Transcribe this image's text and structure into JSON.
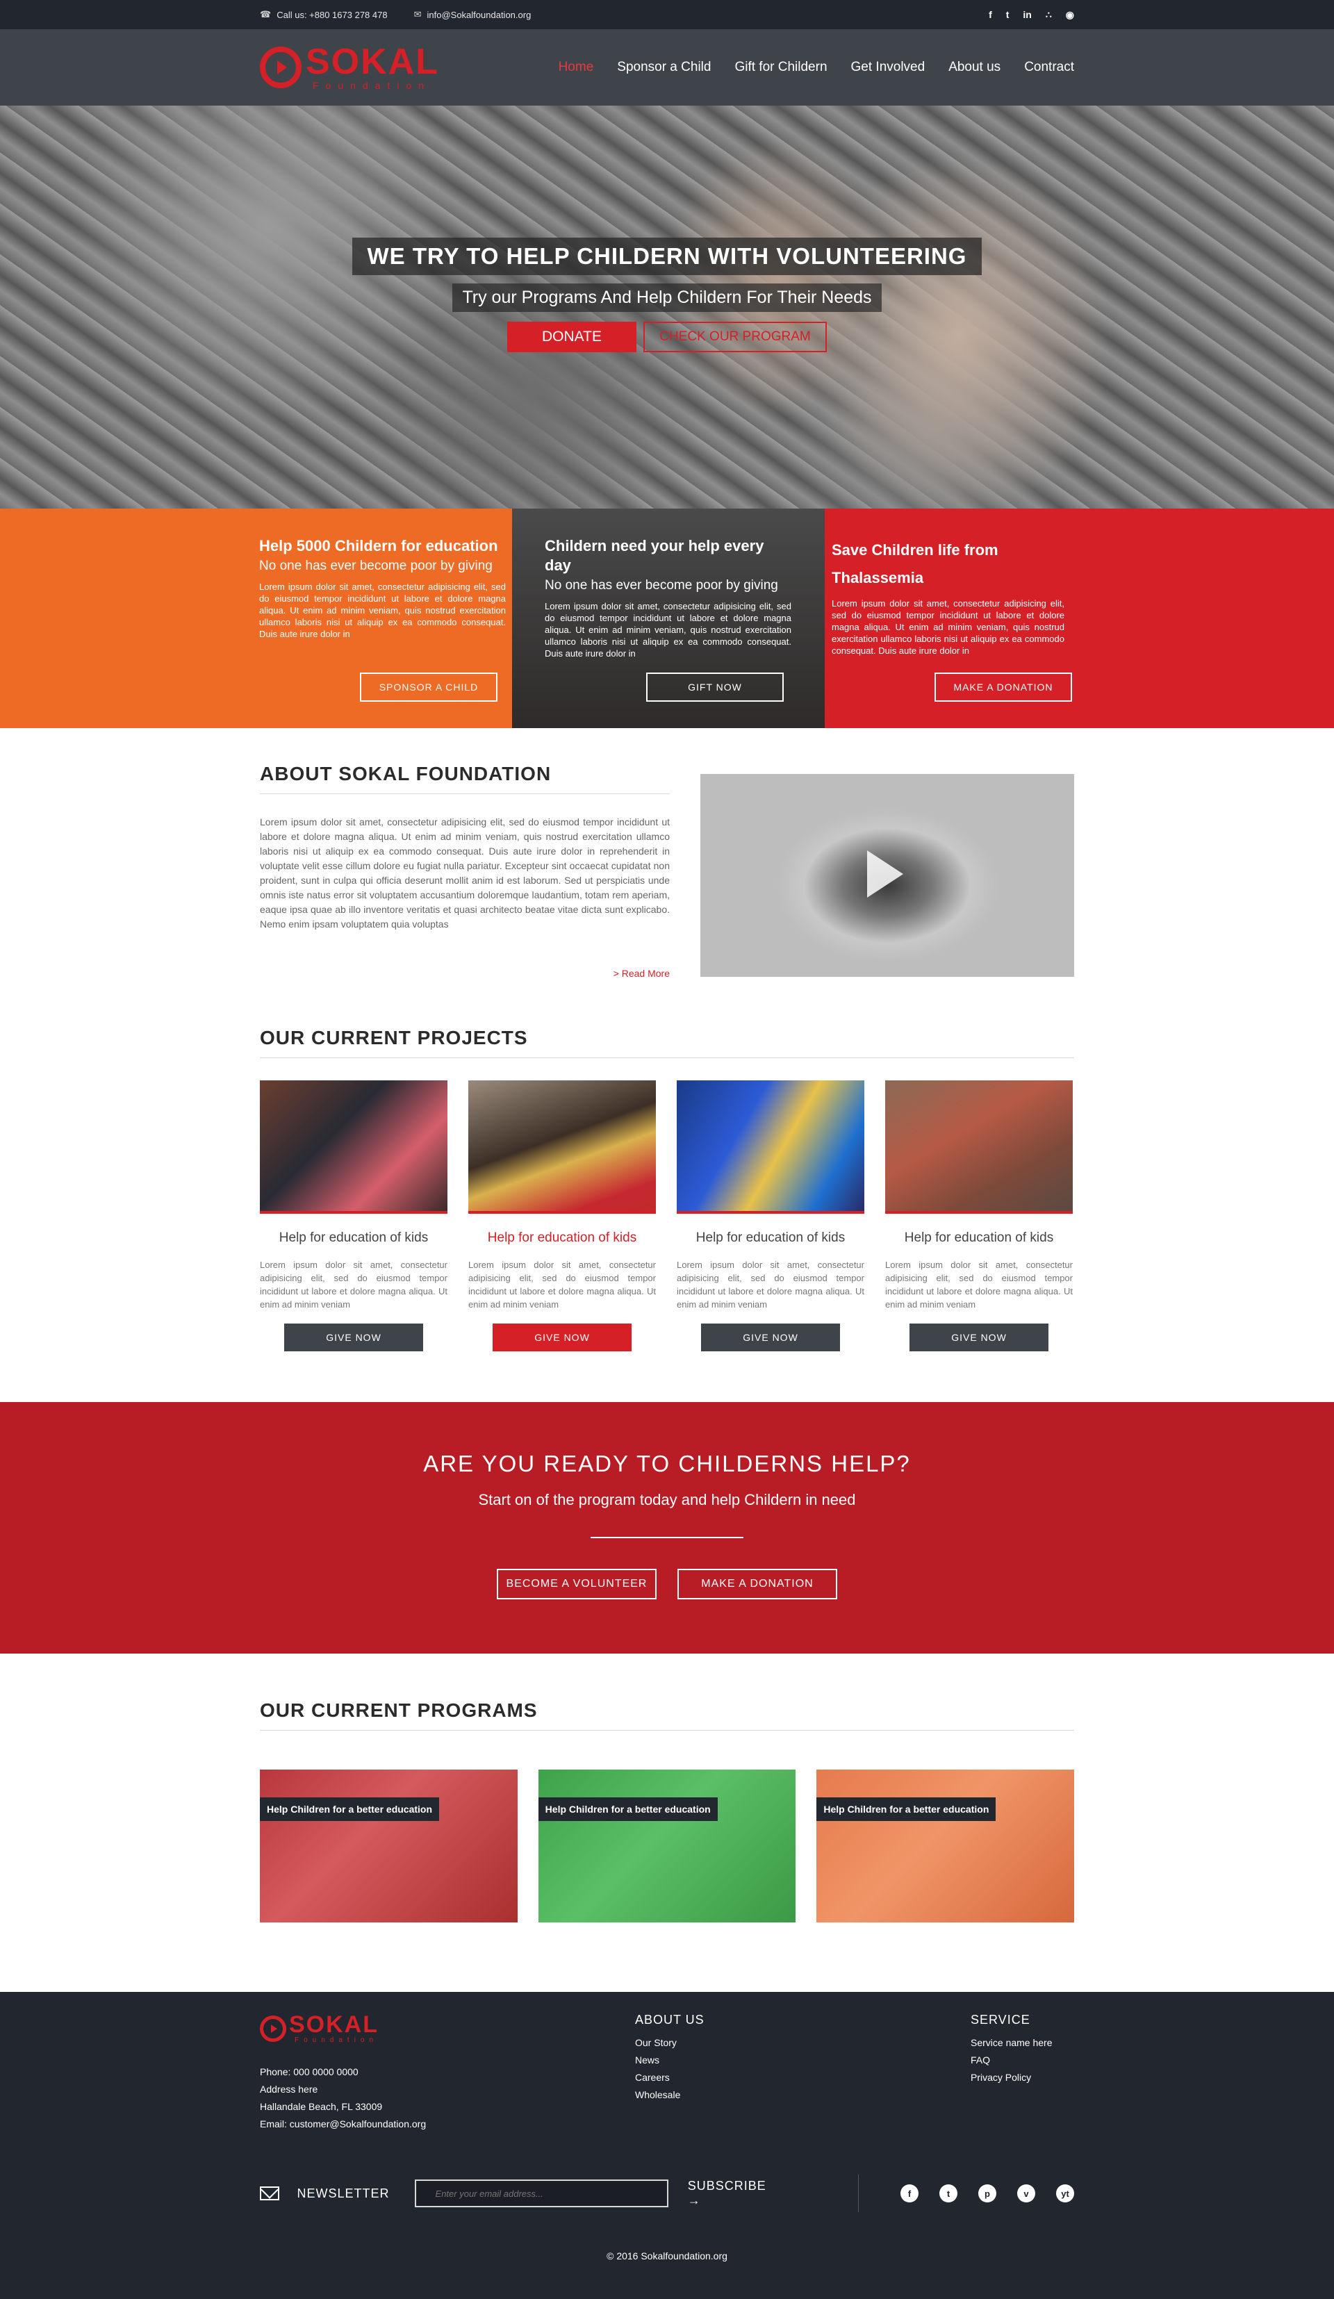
{
  "topbar": {
    "phone": "Call us: +880 1673 278 478",
    "email": "info@Sokalfoundation.org",
    "social": [
      "f",
      "t",
      "in",
      "rss",
      "dribbble"
    ]
  },
  "header": {
    "logo_name": "SOKAL",
    "logo_sub": "Foundation",
    "nav": [
      "Home",
      "Sponsor a Child",
      "Gift for Childern",
      "Get Involved",
      "About us",
      "Contract"
    ],
    "active_nav": "Home"
  },
  "hero": {
    "title": "WE TRY TO HELP CHILDERN WITH VOLUNTEERING",
    "subtitle": "Try our Programs And Help Childern For Their Needs",
    "donate": "DONATE",
    "check": "CHECK OUR PROGRAM"
  },
  "features": [
    {
      "title": "Help 5000 Childern for education",
      "subtitle": "No one has ever become poor by giving",
      "text": "Lorem ipsum dolor sit amet, consectetur adipisicing elit, sed do eiusmod tempor incididunt ut labore et dolore magna aliqua. Ut enim ad minim veniam, quis nostrud exercitation ullamco laboris nisi ut aliquip ex ea commodo consequat. Duis aute irure dolor in",
      "button": "SPONSOR A CHILD"
    },
    {
      "title": "Childern need your help every day",
      "subtitle": "No one has ever become poor by giving",
      "text": "Lorem ipsum dolor sit amet, consectetur adipisicing elit, sed do eiusmod tempor incididunt ut labore et dolore magna aliqua. Ut enim ad minim veniam, quis nostrud exercitation ullamco laboris nisi ut aliquip ex ea commodo consequat. Duis aute irure dolor in",
      "button": "GIFT NOW"
    },
    {
      "title": "Save Children life from Thalassemia",
      "subtitle": "",
      "text": "Lorem ipsum dolor sit amet, consectetur adipisicing elit, sed do eiusmod tempor incididunt ut labore et dolore magna aliqua. Ut enim ad minim veniam, quis nostrud exercitation ullamco laboris nisi ut aliquip ex ea commodo consequat. Duis aute irure dolor in",
      "button": "MAKE A DONATION"
    }
  ],
  "about": {
    "title": "ABOUT SOKAL FOUNDATION",
    "text": "Lorem ipsum dolor sit amet, consectetur adipisicing elit, sed do eiusmod tempor incididunt ut labore et dolore magna aliqua. Ut enim ad minim veniam, quis nostrud exercitation ullamco laboris nisi ut aliquip ex ea commodo consequat. Duis aute irure dolor in reprehenderit in voluptate velit esse cillum dolore eu fugiat nulla pariatur. Excepteur sint occaecat cupidatat non proident, sunt in culpa qui officia deserunt mollit anim id est laborum. Sed ut perspiciatis unde omnis iste natus error sit voluptatem accusantium doloremque laudantium, totam rem aperiam, eaque ipsa quae ab illo inventore veritatis et quasi architecto beatae vitae dicta sunt explicabo. Nemo enim ipsam voluptatem quia voluptas",
    "read_more": ">  Read More"
  },
  "projects": {
    "title": "OUR CURRENT PROJECTS",
    "items": [
      {
        "title": "Help for education of kids",
        "text": "Lorem ipsum dolor sit amet, consectetur adipisicing elit, sed do eiusmod tempor incididunt ut labore et dolore magna aliqua. Ut enim ad minim veniam",
        "button": "GIVE NOW"
      },
      {
        "title": "Help for education of kids",
        "text": "Lorem ipsum dolor sit amet, consectetur adipisicing elit, sed do eiusmod tempor incididunt ut labore et dolore magna aliqua. Ut enim ad minim veniam",
        "button": "GIVE NOW"
      },
      {
        "title": "Help for education of kids",
        "text": "Lorem ipsum dolor sit amet, consectetur adipisicing elit, sed do eiusmod tempor incididunt ut labore et dolore magna aliqua. Ut enim ad minim veniam",
        "button": "GIVE NOW"
      },
      {
        "title": "Help for education of kids",
        "text": "Lorem ipsum dolor sit amet, consectetur adipisicing elit, sed do eiusmod tempor incididunt ut labore et dolore magna aliqua. Ut enim ad minim veniam",
        "button": "GIVE NOW"
      }
    ]
  },
  "cta": {
    "title": "ARE YOU READY TO CHILDERNS HELP?",
    "subtitle": "Start on of the program today and help Childern in need",
    "volunteer": "BECOME A VOLUNTEER",
    "donation": "MAKE A DONATION"
  },
  "programs": {
    "title": "OUR CURRENT PROGRAMS",
    "items": [
      {
        "label": "Help Children for a better education"
      },
      {
        "label": "Help Children for a better education"
      },
      {
        "label": "Help Children for a better education"
      }
    ]
  },
  "footer": {
    "phone": "Phone: 000  0000 0000",
    "address": "Address here",
    "city": "Hallandale Beach, FL 33009",
    "email": "Email: customer@Sokalfoundation.org",
    "about_title": "ABOUT US",
    "about_links": [
      "Our Story",
      "News",
      "Careers",
      "Wholesale"
    ],
    "service_title": "SERVICE",
    "service_links": [
      "Service name here",
      "FAQ",
      "Privacy Policy"
    ],
    "newsletter": "NEWSLETTER",
    "newsletter_placeholder": "Enter your email address...",
    "subscribe": "SUBSCRIBE  →",
    "social": [
      "f",
      "t",
      "p",
      "v",
      "yt"
    ],
    "copyright": "© 2016 Sokalfoundation.org"
  },
  "colors": {
    "brand_red": "#d52027",
    "orange": "#ee6b26",
    "dark": "#22262e"
  }
}
